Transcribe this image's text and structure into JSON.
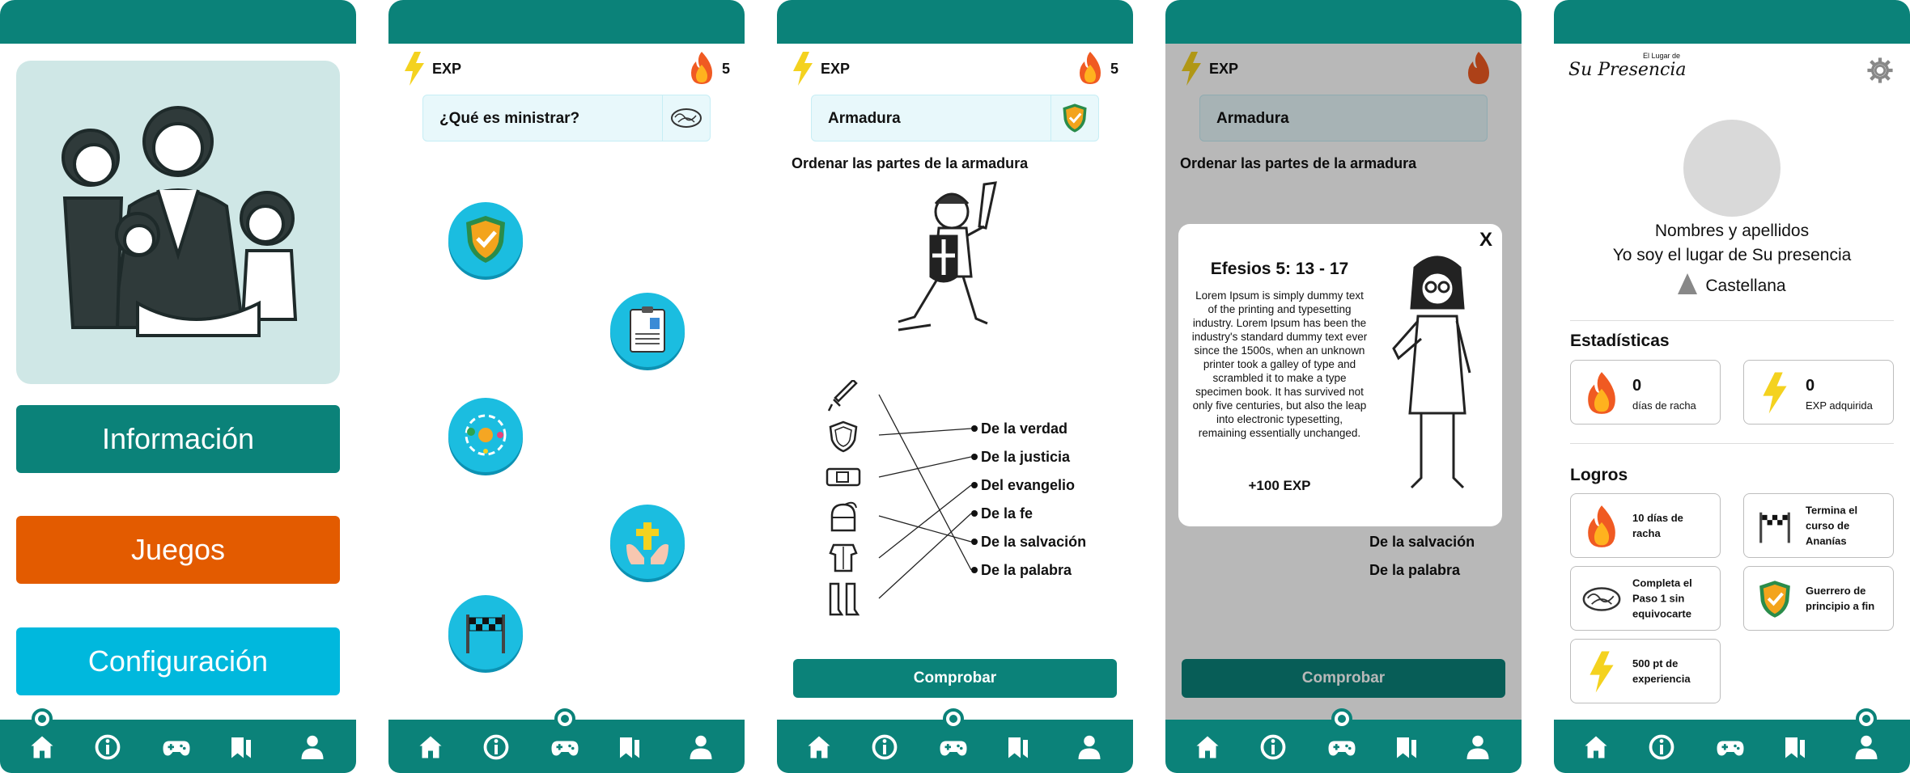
{
  "colors": {
    "primary": "#0b8279",
    "orange": "#e35b00",
    "cyan": "#00b8dd",
    "level_blue": "#1bbde0"
  },
  "nav_icons": [
    "home-icon",
    "info-icon",
    "gamepad-icon",
    "bookmark-icon",
    "user-icon"
  ],
  "home": {
    "buttons": {
      "info": "Información",
      "games": "Juegos",
      "settings": "Configuración"
    }
  },
  "header": {
    "exp_label": "EXP",
    "streak": "5"
  },
  "path_screen": {
    "topic": "¿Qué es ministrar?"
  },
  "armor_screen": {
    "topic": "Armadura",
    "instruction": "Ordenar las partes de la armadura",
    "answers": [
      "De la verdad",
      "De la justicia",
      "Del evangelio",
      "De la fe",
      "De la salvación",
      "De la palabra"
    ],
    "check_button": "Comprobar"
  },
  "modal": {
    "close": "X",
    "title": "Efesios 5: 13 - 17",
    "body": "Lorem Ipsum is simply dummy text of the printing and typesetting industry. Lorem Ipsum has been the industry's standard dummy text ever since the 1500s, when an unknown printer took a galley of type and scrambled it to make a type specimen book. It has survived not only five centuries, but also the leap into electronic typesetting, remaining essentially unchanged.",
    "reward": "+100 EXP"
  },
  "profile": {
    "logo_small": "El Lugar de",
    "logo_main": "Su Presencia",
    "name": "Nombres y apellidos",
    "tagline": "Yo soy el lugar de Su presencia",
    "church": "Castellana",
    "stats_title": "Estadísticas",
    "stats": [
      {
        "num": "0",
        "label": "días de racha"
      },
      {
        "num": "0",
        "label": "EXP adquirida"
      }
    ],
    "achievements_title": "Logros",
    "achievements": [
      "10 días de racha",
      "Termina el curso de Ananías",
      "Completa el Paso 1 sin equivocarte",
      "Guerrero de principio a fin",
      "500 pt de experiencia"
    ]
  }
}
